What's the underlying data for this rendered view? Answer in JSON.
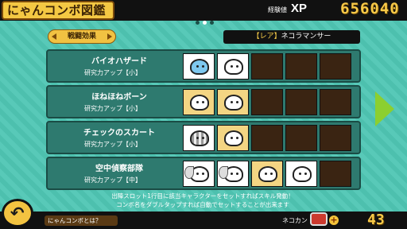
{
  "header": {
    "title": "にゃんコンボ図鑑",
    "xp_small_label": "経験値",
    "xp_label": "XP",
    "xp_value": "656040"
  },
  "pager": {
    "pages": 3,
    "current": 2
  },
  "effect_selector": {
    "label": "戦闘効果"
  },
  "filter": {
    "rarity_tag": "【レア】",
    "unit_name": "ネコラマンサー"
  },
  "combos": [
    {
      "name": "バイオハザード",
      "effect": "研究力アップ【小】",
      "slots": [
        "blue-cat",
        "skeleton",
        "empty",
        "empty",
        "empty"
      ]
    },
    {
      "name": "ほねほねボーン",
      "effect": "研究力アップ【小】",
      "slots": [
        "gold-cat",
        "gold-cat",
        "empty",
        "empty",
        "empty"
      ]
    },
    {
      "name": "チェックのスカート",
      "effect": "研究力アップ【小】",
      "slots": [
        "skirt-cat",
        "gold-cat",
        "empty",
        "empty",
        "empty"
      ]
    },
    {
      "name": "空中偵察部隊",
      "effect": "研究力アップ【中】",
      "slots": [
        "winged-cat",
        "winged-cat",
        "gold-cat",
        "white-cat",
        "empty"
      ]
    }
  ],
  "hint": {
    "line1": "出陣スロット1行目に該当キャラクターをセットすればスキル発動！",
    "line2": "コンボ名をダブルタップすれば自動でセットすることが出来ます"
  },
  "footer": {
    "help_label": "にゃんコンボとは？",
    "catcan_label": "ネコカン",
    "catcan_count": "43",
    "add_label": "+"
  },
  "colors": {
    "background": "#4fc6b4",
    "row_bg": "#2e7a6f",
    "accent": "#f4c843",
    "next_arrow": "#8ccf2f"
  },
  "icons": {
    "back": "back-arrow-icon",
    "next": "next-page-arrow-icon",
    "catcan": "catcan-icon"
  }
}
